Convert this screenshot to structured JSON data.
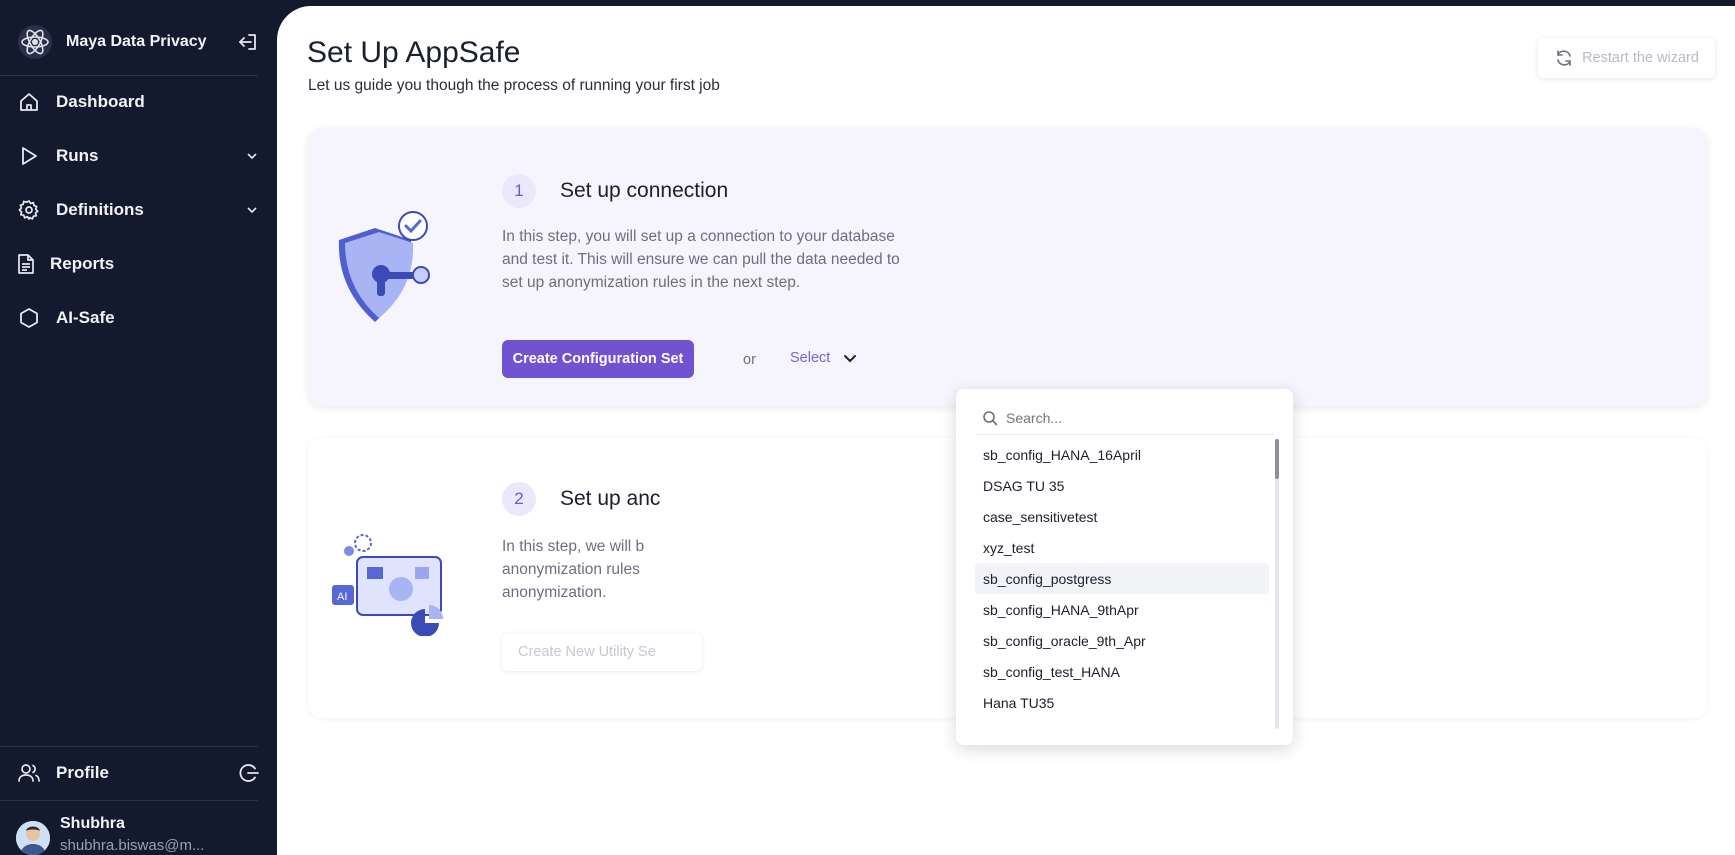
{
  "sidebar": {
    "brand_name": "Maya Data Privacy",
    "nav": [
      {
        "label": "Dashboard",
        "icon": "home-icon"
      },
      {
        "label": "Runs",
        "icon": "play-icon",
        "has_chevron": true
      },
      {
        "label": "Definitions",
        "icon": "gear-icon",
        "has_chevron": true
      },
      {
        "label": "Reports",
        "icon": "document-icon"
      },
      {
        "label": "AI-Safe",
        "icon": "hexagon-icon"
      }
    ],
    "profile_label": "Profile",
    "user": {
      "name": "Shubhra",
      "email": "shubhra.biswas@m..."
    }
  },
  "header": {
    "title": "Set Up AppSafe",
    "subtitle": "Let us guide you though the process of running your first job",
    "restart_label": "Restart the wizard"
  },
  "steps": [
    {
      "number": "1",
      "title": "Set up connection",
      "description": "In this step, you will set up a connection to your database and test it. This will ensure we can pull the data needed to set up anonymization rules in the next step.",
      "primary_button": "Create Configuration Set",
      "or_text": "or",
      "select_label": "Select"
    },
    {
      "number": "2",
      "title": "Set up anc",
      "description": "In this step, we will b anonymization rules anonymization.",
      "button": "Create New Utility Se"
    }
  ],
  "dropdown": {
    "search_placeholder": "Search...",
    "items": [
      "sb_config_HANA_16April",
      "DSAG TU 35",
      "case_sensitivetest",
      "xyz_test",
      "sb_config_postgress",
      "sb_config_HANA_9thApr",
      "sb_config_oracle_9th_Apr",
      "sb_config_test_HANA",
      "Hana TU35"
    ],
    "highlighted_index": 4
  },
  "colors": {
    "sidebar_bg": "#141a2e",
    "accent": "#7053d1",
    "card_bg": "#f6f4fd"
  }
}
